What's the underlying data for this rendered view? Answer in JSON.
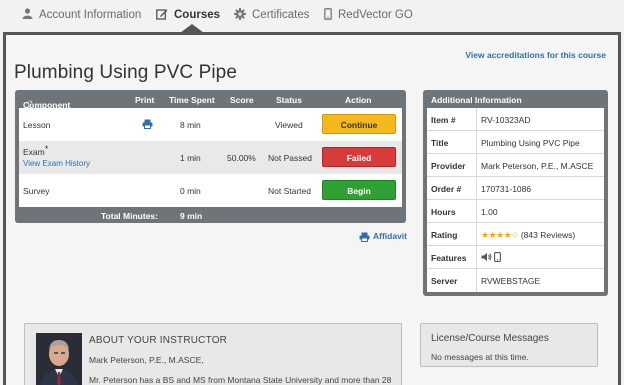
{
  "nav": {
    "items": [
      {
        "label": "Account Information",
        "icon": "user-icon"
      },
      {
        "label": "Courses",
        "icon": "edit-icon"
      },
      {
        "label": "Certificates",
        "icon": "gear-badge-icon"
      },
      {
        "label": "RedVector GO",
        "icon": "mobile-icon"
      }
    ],
    "active": "Courses"
  },
  "accreditations_link": "View accreditations for this course",
  "course_title": "Plumbing Using PVC Pipe",
  "components": {
    "headers": {
      "component": "Component",
      "required": "(* Required)",
      "print": "Print",
      "time_spent": "Time Spent",
      "score": "Score",
      "status": "Status",
      "action": "Action"
    },
    "rows": [
      {
        "name": "Lesson",
        "required": false,
        "has_print": true,
        "time": "8 min",
        "score": "",
        "status": "Viewed",
        "action": "Continue",
        "action_style": "continue"
      },
      {
        "name": "Exam",
        "required": true,
        "sub_link": "View Exam History",
        "has_print": false,
        "time": "1 min",
        "score": "50.00%",
        "status": "Not Passed",
        "action": "Failed",
        "action_style": "failed"
      },
      {
        "name": "Survey",
        "required": false,
        "has_print": false,
        "time": "0 min",
        "score": "",
        "status": "Not Started",
        "action": "Begin",
        "action_style": "begin"
      }
    ],
    "total_label": "Total Minutes:",
    "total_value": "9 min",
    "required_marker": "*"
  },
  "affidavit_label": "Affidavit",
  "additional_info": {
    "title": "Additional Information",
    "rows": [
      {
        "key": "Item #",
        "value": "RV-10323AD"
      },
      {
        "key": "Title",
        "value": "Plumbing Using PVC Pipe"
      },
      {
        "key": "Provider",
        "value": "Mark Peterson, P.E., M.ASCE"
      },
      {
        "key": "Order #",
        "value": "170731-1086"
      },
      {
        "key": "Hours",
        "value": "1.00"
      },
      {
        "key": "Rating",
        "value": "(843 Reviews)",
        "stars": "★★★★☆",
        "rating": 4
      },
      {
        "key": "Features",
        "value": "",
        "icons": [
          "speaker-icon",
          "mobile-icon"
        ]
      },
      {
        "key": "Server",
        "value": "RVWEBSTAGE"
      }
    ]
  },
  "instructor": {
    "title": "ABOUT YOUR INSTRUCTOR",
    "name": "Mark Peterson, P.E., M.ASCE,",
    "bio": "Mr. Peterson has a BS and MS from Montana State University and more than 28"
  },
  "license": {
    "title": "License/Course Messages",
    "message": "No messages at this time."
  },
  "colors": {
    "link": "#2f6fae",
    "continue": "#f4b81a",
    "failed": "#d83b3b",
    "begin": "#2fa033",
    "header_bg": "#6f7478",
    "frame": "#555555",
    "stars": "#f2a900"
  }
}
